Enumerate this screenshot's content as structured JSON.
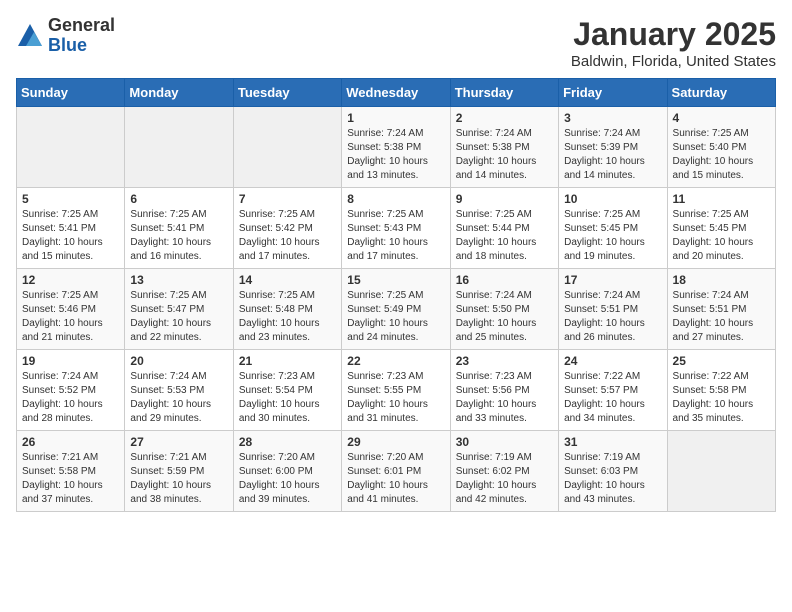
{
  "header": {
    "logo_line1": "General",
    "logo_line2": "Blue",
    "title": "January 2025",
    "subtitle": "Baldwin, Florida, United States"
  },
  "weekdays": [
    "Sunday",
    "Monday",
    "Tuesday",
    "Wednesday",
    "Thursday",
    "Friday",
    "Saturday"
  ],
  "weeks": [
    [
      {
        "day": "",
        "info": ""
      },
      {
        "day": "",
        "info": ""
      },
      {
        "day": "",
        "info": ""
      },
      {
        "day": "1",
        "info": "Sunrise: 7:24 AM\nSunset: 5:38 PM\nDaylight: 10 hours\nand 13 minutes."
      },
      {
        "day": "2",
        "info": "Sunrise: 7:24 AM\nSunset: 5:38 PM\nDaylight: 10 hours\nand 14 minutes."
      },
      {
        "day": "3",
        "info": "Sunrise: 7:24 AM\nSunset: 5:39 PM\nDaylight: 10 hours\nand 14 minutes."
      },
      {
        "day": "4",
        "info": "Sunrise: 7:25 AM\nSunset: 5:40 PM\nDaylight: 10 hours\nand 15 minutes."
      }
    ],
    [
      {
        "day": "5",
        "info": "Sunrise: 7:25 AM\nSunset: 5:41 PM\nDaylight: 10 hours\nand 15 minutes."
      },
      {
        "day": "6",
        "info": "Sunrise: 7:25 AM\nSunset: 5:41 PM\nDaylight: 10 hours\nand 16 minutes."
      },
      {
        "day": "7",
        "info": "Sunrise: 7:25 AM\nSunset: 5:42 PM\nDaylight: 10 hours\nand 17 minutes."
      },
      {
        "day": "8",
        "info": "Sunrise: 7:25 AM\nSunset: 5:43 PM\nDaylight: 10 hours\nand 17 minutes."
      },
      {
        "day": "9",
        "info": "Sunrise: 7:25 AM\nSunset: 5:44 PM\nDaylight: 10 hours\nand 18 minutes."
      },
      {
        "day": "10",
        "info": "Sunrise: 7:25 AM\nSunset: 5:45 PM\nDaylight: 10 hours\nand 19 minutes."
      },
      {
        "day": "11",
        "info": "Sunrise: 7:25 AM\nSunset: 5:45 PM\nDaylight: 10 hours\nand 20 minutes."
      }
    ],
    [
      {
        "day": "12",
        "info": "Sunrise: 7:25 AM\nSunset: 5:46 PM\nDaylight: 10 hours\nand 21 minutes."
      },
      {
        "day": "13",
        "info": "Sunrise: 7:25 AM\nSunset: 5:47 PM\nDaylight: 10 hours\nand 22 minutes."
      },
      {
        "day": "14",
        "info": "Sunrise: 7:25 AM\nSunset: 5:48 PM\nDaylight: 10 hours\nand 23 minutes."
      },
      {
        "day": "15",
        "info": "Sunrise: 7:25 AM\nSunset: 5:49 PM\nDaylight: 10 hours\nand 24 minutes."
      },
      {
        "day": "16",
        "info": "Sunrise: 7:24 AM\nSunset: 5:50 PM\nDaylight: 10 hours\nand 25 minutes."
      },
      {
        "day": "17",
        "info": "Sunrise: 7:24 AM\nSunset: 5:51 PM\nDaylight: 10 hours\nand 26 minutes."
      },
      {
        "day": "18",
        "info": "Sunrise: 7:24 AM\nSunset: 5:51 PM\nDaylight: 10 hours\nand 27 minutes."
      }
    ],
    [
      {
        "day": "19",
        "info": "Sunrise: 7:24 AM\nSunset: 5:52 PM\nDaylight: 10 hours\nand 28 minutes."
      },
      {
        "day": "20",
        "info": "Sunrise: 7:24 AM\nSunset: 5:53 PM\nDaylight: 10 hours\nand 29 minutes."
      },
      {
        "day": "21",
        "info": "Sunrise: 7:23 AM\nSunset: 5:54 PM\nDaylight: 10 hours\nand 30 minutes."
      },
      {
        "day": "22",
        "info": "Sunrise: 7:23 AM\nSunset: 5:55 PM\nDaylight: 10 hours\nand 31 minutes."
      },
      {
        "day": "23",
        "info": "Sunrise: 7:23 AM\nSunset: 5:56 PM\nDaylight: 10 hours\nand 33 minutes."
      },
      {
        "day": "24",
        "info": "Sunrise: 7:22 AM\nSunset: 5:57 PM\nDaylight: 10 hours\nand 34 minutes."
      },
      {
        "day": "25",
        "info": "Sunrise: 7:22 AM\nSunset: 5:58 PM\nDaylight: 10 hours\nand 35 minutes."
      }
    ],
    [
      {
        "day": "26",
        "info": "Sunrise: 7:21 AM\nSunset: 5:58 PM\nDaylight: 10 hours\nand 37 minutes."
      },
      {
        "day": "27",
        "info": "Sunrise: 7:21 AM\nSunset: 5:59 PM\nDaylight: 10 hours\nand 38 minutes."
      },
      {
        "day": "28",
        "info": "Sunrise: 7:20 AM\nSunset: 6:00 PM\nDaylight: 10 hours\nand 39 minutes."
      },
      {
        "day": "29",
        "info": "Sunrise: 7:20 AM\nSunset: 6:01 PM\nDaylight: 10 hours\nand 41 minutes."
      },
      {
        "day": "30",
        "info": "Sunrise: 7:19 AM\nSunset: 6:02 PM\nDaylight: 10 hours\nand 42 minutes."
      },
      {
        "day": "31",
        "info": "Sunrise: 7:19 AM\nSunset: 6:03 PM\nDaylight: 10 hours\nand 43 minutes."
      },
      {
        "day": "",
        "info": ""
      }
    ]
  ]
}
